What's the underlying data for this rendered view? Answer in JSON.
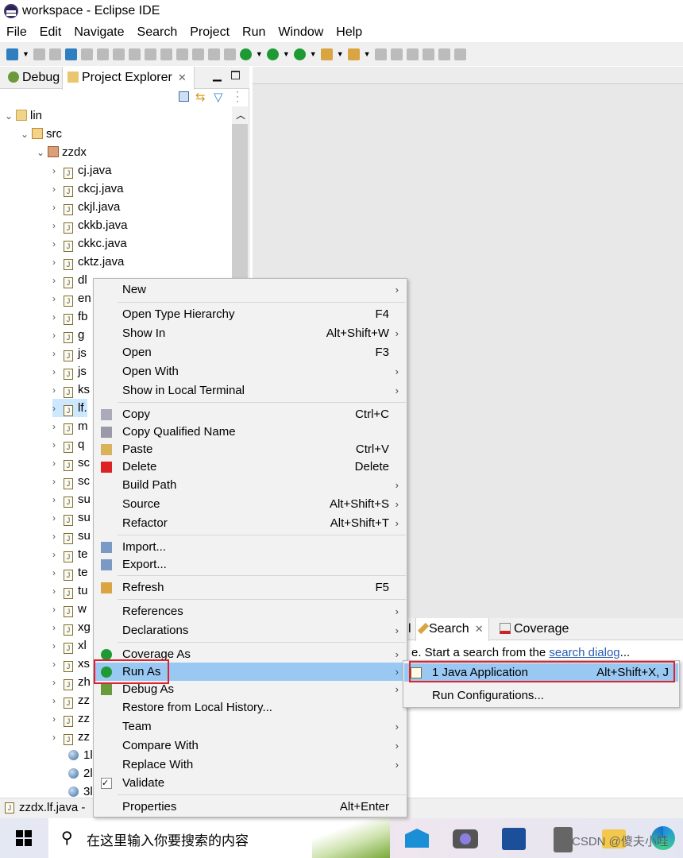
{
  "window": {
    "title": "workspace - Eclipse IDE"
  },
  "menubar": [
    "File",
    "Edit",
    "Navigate",
    "Search",
    "Project",
    "Run",
    "Window",
    "Help"
  ],
  "left_panel": {
    "tabs": [
      {
        "label": "Debug",
        "icon": "bug-icon"
      },
      {
        "label": "Project Explorer",
        "icon": "project-explorer-icon",
        "active": true
      }
    ]
  },
  "tree": {
    "project": "lin",
    "folder": "src",
    "package": "zzdx",
    "files": [
      "cj.java",
      "ckcj.java",
      "ckjl.java",
      "ckkb.java",
      "ckkc.java",
      "cktz.java",
      "dl",
      "en",
      "fb",
      "g",
      "js",
      "js",
      "ks",
      "lf.",
      "m",
      "q",
      "sc",
      "sc",
      "su",
      "su",
      "su",
      "te",
      "te",
      "tu",
      "w",
      "xg",
      "xl",
      "xs",
      "zh",
      "zz",
      "zz",
      "zz"
    ],
    "selected_index": 13,
    "other": [
      "1l",
      "2l",
      "3l"
    ]
  },
  "bottom_panel": {
    "tabs": [
      {
        "label": "l"
      },
      {
        "label": "Search",
        "icon": "search-flashlight-icon",
        "active": true
      },
      {
        "label": "Coverage",
        "icon": "coverage-icon"
      }
    ],
    "message_prefix": "e. Start a search from the ",
    "message_link": "search dialog",
    "message_suffix": "..."
  },
  "context_menu": {
    "items": [
      {
        "label": "New",
        "submenu": true
      },
      {
        "sep": true
      },
      {
        "label": "Open Type Hierarchy",
        "shortcut": "F4"
      },
      {
        "label": "Show In",
        "shortcut": "Alt+Shift+W",
        "submenu": true
      },
      {
        "label": "Open",
        "shortcut": "F3"
      },
      {
        "label": "Open With",
        "submenu": true
      },
      {
        "label": "Show in Local Terminal",
        "submenu": true
      },
      {
        "sep": true
      },
      {
        "label": "Copy",
        "shortcut": "Ctrl+C",
        "icon": "copy-icon"
      },
      {
        "label": "Copy Qualified Name",
        "icon": "copy-qualified-icon"
      },
      {
        "label": "Paste",
        "shortcut": "Ctrl+V",
        "icon": "paste-icon"
      },
      {
        "label": "Delete",
        "shortcut": "Delete",
        "icon": "delete-icon"
      },
      {
        "label": "Build Path",
        "submenu": true
      },
      {
        "label": "Source",
        "shortcut": "Alt+Shift+S",
        "submenu": true
      },
      {
        "label": "Refactor",
        "shortcut": "Alt+Shift+T",
        "submenu": true
      },
      {
        "sep": true
      },
      {
        "label": "Import...",
        "icon": "import-icon"
      },
      {
        "label": "Export...",
        "icon": "export-icon"
      },
      {
        "sep": true
      },
      {
        "label": "Refresh",
        "shortcut": "F5",
        "icon": "refresh-icon"
      },
      {
        "sep": true
      },
      {
        "label": "References",
        "submenu": true
      },
      {
        "label": "Declarations",
        "submenu": true
      },
      {
        "sep": true
      },
      {
        "label": "Coverage As",
        "submenu": true,
        "icon": "coverage-run-icon"
      },
      {
        "label": "Run As",
        "submenu": true,
        "icon": "run-icon",
        "highlighted": true
      },
      {
        "label": "Debug As",
        "submenu": true,
        "icon": "debug-icon"
      },
      {
        "label": "Restore from Local History..."
      },
      {
        "label": "Team",
        "submenu": true
      },
      {
        "label": "Compare With",
        "submenu": true
      },
      {
        "label": "Replace With",
        "submenu": true
      },
      {
        "label": "Validate",
        "icon": "checkbox-icon"
      },
      {
        "sep": true
      },
      {
        "label": "Properties",
        "shortcut": "Alt+Enter"
      }
    ]
  },
  "run_as_submenu": {
    "items": [
      {
        "label": "1 Java Application",
        "shortcut": "Alt+Shift+X, J",
        "icon": "java-app-icon",
        "highlighted": true
      },
      {
        "label": "Run Configurations..."
      }
    ]
  },
  "status_bar": {
    "text": "zzdx.lf.java -"
  },
  "taskbar": {
    "search_placeholder": "在这里输入你要搜索的内容",
    "watermark": "CSDN @傻夫小哇"
  },
  "colors": {
    "highlight": "#99c9f3",
    "annotation": "#e0202a",
    "link": "#2a5db0"
  }
}
